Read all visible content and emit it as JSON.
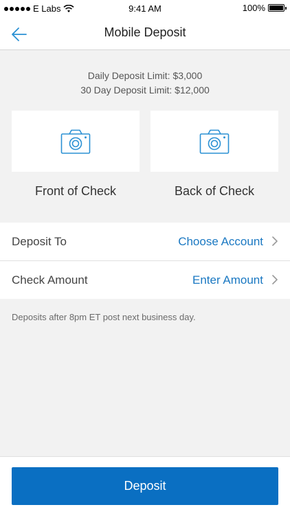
{
  "status_bar": {
    "carrier": "E Labs",
    "time": "9:41 AM",
    "battery": "100%"
  },
  "nav": {
    "title": "Mobile Deposit",
    "back_icon": "back-arrow-icon"
  },
  "limits": {
    "daily": "Daily Deposit Limit: $3,000",
    "thirty_day": "30 Day Deposit Limit: $12,000"
  },
  "capture": {
    "front_label": "Front of Check",
    "back_label": "Back of Check",
    "icon": "camera-icon"
  },
  "form": {
    "deposit_to": {
      "label": "Deposit To",
      "value": "Choose Account"
    },
    "check_amount": {
      "label": "Check Amount",
      "value": "Enter Amount"
    }
  },
  "footnote": "Deposits after 8pm ET post next business day.",
  "deposit_button": "Deposit",
  "colors": {
    "accent": "#1a78c2",
    "button": "#0a6fc2",
    "background": "#f2f2f2",
    "icon": "#2a90d4"
  }
}
